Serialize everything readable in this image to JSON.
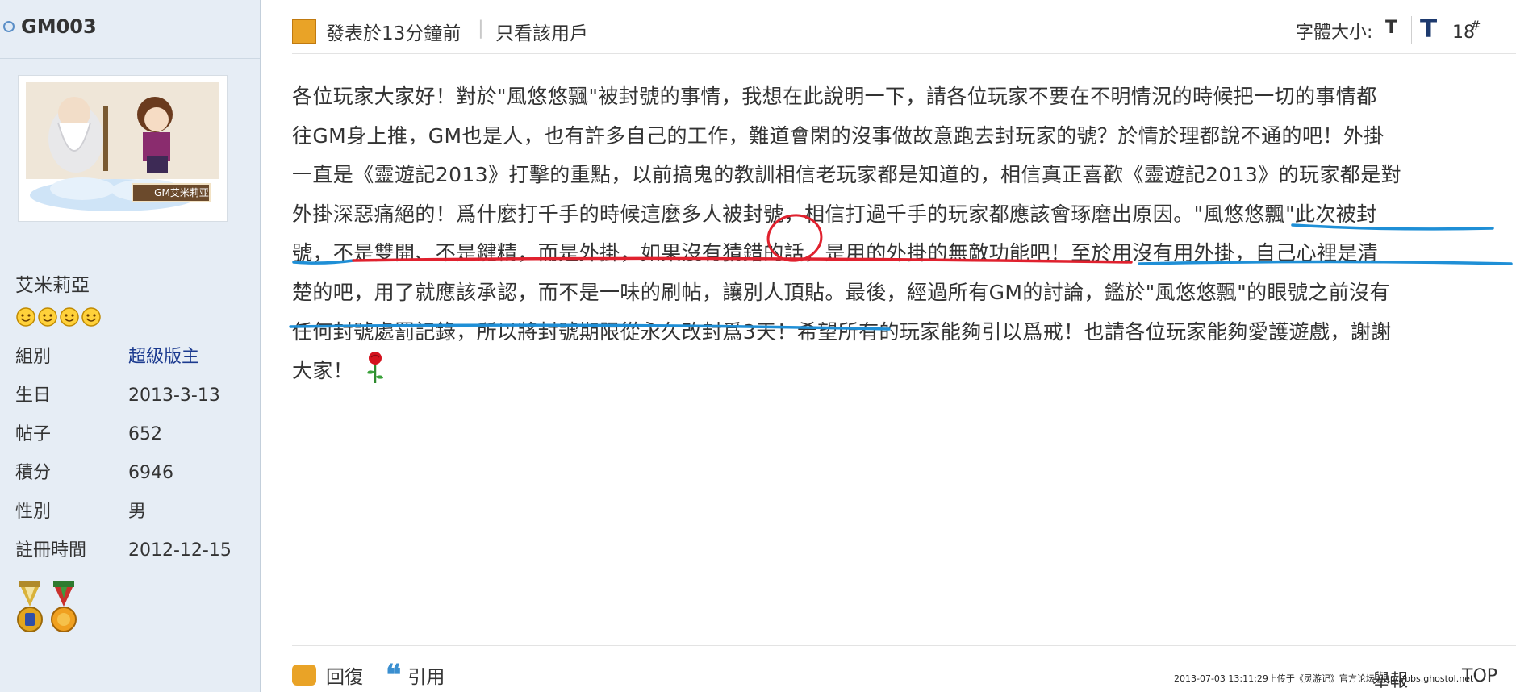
{
  "user": {
    "name": "GM003",
    "avatar_caption": "GM艾米莉亚",
    "title": "艾米莉亞",
    "profile": [
      {
        "key": "組別",
        "value": "超級版主",
        "is_link": true
      },
      {
        "key": "生日",
        "value": "2013-3-13",
        "is_link": false
      },
      {
        "key": "帖子",
        "value": "652",
        "is_link": false
      },
      {
        "key": "積分",
        "value": "6946",
        "is_link": false
      },
      {
        "key": "性別",
        "value": "男",
        "is_link": false
      },
      {
        "key": "註冊時間",
        "value": "2012-12-15",
        "is_link": false
      }
    ]
  },
  "post": {
    "time": "發表於13分鐘前",
    "separator": "|",
    "only_user": "只看該用戶",
    "font_size_label": "字體大小:",
    "font_small": "T",
    "font_large": "T",
    "floor": "18",
    "floor_mark": "#",
    "lines": [
      "各位玩家大家好！對於\"風悠悠飄\"被封號的事情，我想在此說明一下，請各位玩家不要在不明情況的時候把一切的事情都",
      "往GM身上推，GM也是人，也有許多自己的工作，難道會閑的沒事做故意跑去封玩家的號？於情於理都說不通的吧！外掛",
      "一直是《靈遊記2013》打擊的重點，以前搞鬼的教訓相信老玩家都是知道的，相信真正喜歡《靈遊記2013》的玩家都是對",
      "外掛深惡痛絕的！爲什麼打千手的時候這麼多人被封號，相信打過千手的玩家都應該會琢磨出原因。\"風悠悠飄\"此次被封",
      "號，不是雙開、不是鍵精，而是外掛，如果沒有猜錯的話，是用的外掛的無敵功能吧！至於用沒有用外掛，自己心裡是清",
      "楚的吧，用了就應該承認，而不是一味的刷帖，讓別人頂貼。最後，經過所有GM的討論，鑑於\"風悠悠飄\"的眼號之前沒有",
      "任何封號處罰記錄，所以將封號期限從永久改封爲3天！希望所有的玩家能夠引以爲戒！也請各位玩家能夠愛護遊戲，謝謝",
      "大家！"
    ]
  },
  "footer": {
    "reply": "回復",
    "quote_glyph": "❝",
    "quote": "引用",
    "report": "舉報",
    "top": "TOP",
    "watermark": "2013-07-03 13:11:29上传于《灵游记》官方论坛 http://bbs.ghostol.net"
  },
  "icons": {
    "online": "online-status-icon",
    "smiley": "rank-smiley-icon",
    "medal": "medal-icon",
    "rose": "rose-icon"
  },
  "colors": {
    "sidebar_bg": "#e6edf5",
    "link": "#1b3a8f",
    "red_mark": "#e0212e",
    "blue_mark": "#1f8fd6",
    "accent_orange": "#e9a327"
  }
}
